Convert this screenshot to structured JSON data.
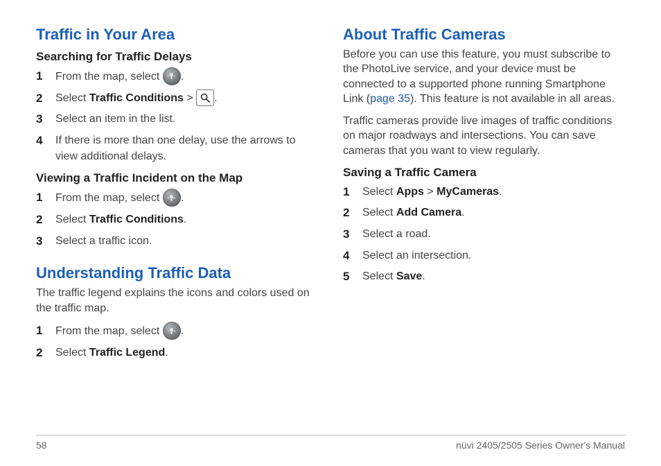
{
  "footer": {
    "page_number": "58",
    "manual_title": "nüvi 2405/2505 Series Owner's Manual"
  },
  "left": {
    "section1": {
      "title": "Traffic in Your Area",
      "sub1": {
        "title": "Searching for Traffic Delays",
        "steps": {
          "s1_a": "From the map, select ",
          "s1_b": ".",
          "s2_a": "Select ",
          "s2_bold": "Traffic Conditions",
          "s2_b": " > ",
          "s2_c": ".",
          "s3": "Select an item in the list.",
          "s4": "If there is more than one delay, use the arrows to view additional delays."
        }
      },
      "sub2": {
        "title": "Viewing a Traffic Incident on the Map",
        "steps": {
          "s1_a": "From the map, select ",
          "s1_b": ".",
          "s2_a": "Select ",
          "s2_bold": "Traffic Conditions",
          "s2_b": ".",
          "s3": "Select a traffic icon."
        }
      }
    },
    "section2": {
      "title": "Understanding Traffic Data",
      "intro": "The traffic legend explains the icons and colors used on the traffic map.",
      "steps": {
        "s1_a": "From the map, select ",
        "s1_b": ".",
        "s2_a": "Select ",
        "s2_bold": "Traffic Legend",
        "s2_b": "."
      }
    }
  },
  "right": {
    "section1": {
      "title": "About Traffic Cameras",
      "intro_a": "Before you can use this feature, you must subscribe to the PhotoLive service, and your device must be connected to a supported phone running Smartphone Link (",
      "intro_link": "page 35",
      "intro_b": "). This feature is not available in all areas.",
      "para2": "Traffic cameras provide live images of traffic conditions on major roadways and intersections. You can save cameras that you want to view regularly.",
      "sub1": {
        "title": "Saving a Traffic Camera",
        "steps": {
          "s1_a": "Select ",
          "s1_bold1": "Apps",
          "s1_b": " > ",
          "s1_bold2": "MyCameras",
          "s1_c": ".",
          "s2_a": "Select ",
          "s2_bold": "Add Camera",
          "s2_b": ".",
          "s3": "Select a road.",
          "s4": "Select an intersection.",
          "s5_a": "Select ",
          "s5_bold": "Save",
          "s5_b": "."
        }
      }
    }
  }
}
